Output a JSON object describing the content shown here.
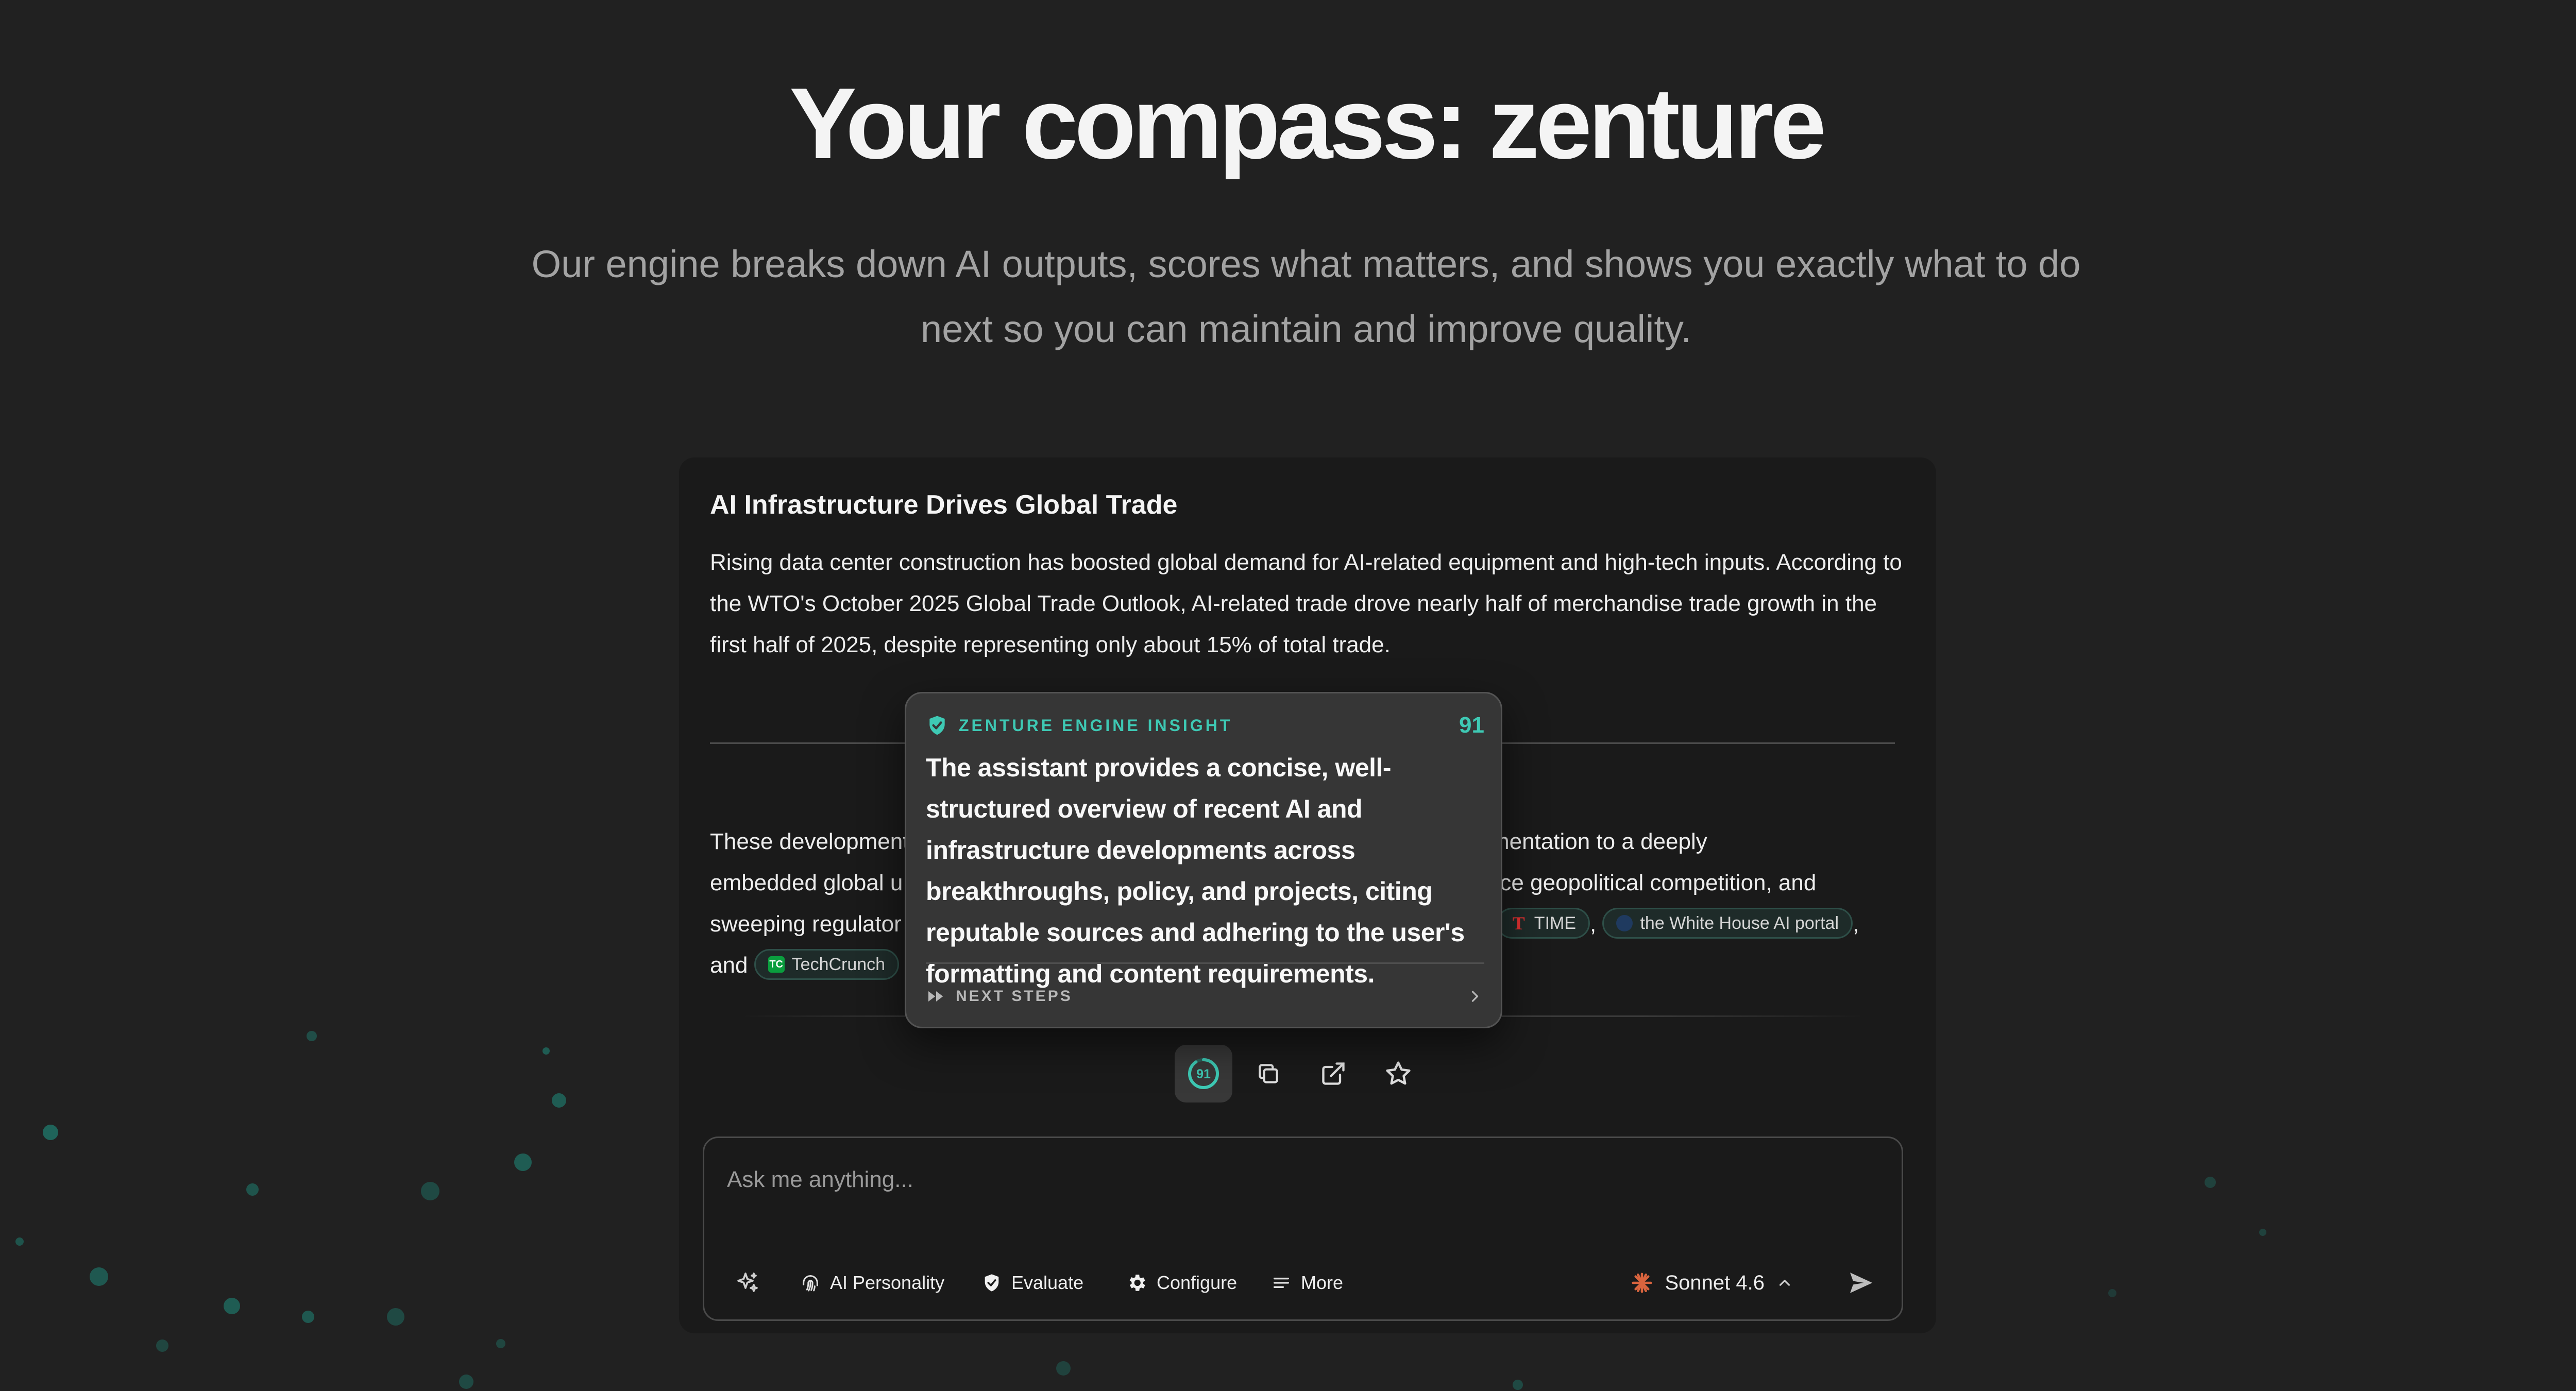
{
  "hero": {
    "title": "Your compass: zenture",
    "subtitle": "Our engine breaks down AI outputs, scores what matters, and shows you exactly what to do next so you can maintain and improve quality."
  },
  "article": {
    "title": "AI Infrastructure Drives Global Trade",
    "paragraph_1": "Rising data center construction has boosted global demand for AI-related equipment and high-tech inputs. According to the WTO's October 2025 Global Trade Outlook, AI-related trade drove nearly half of merchandise trade growth in the first half of 2025, despite representing only about 15% of total trade.",
    "paragraph_2": {
      "start": "These developments",
      "visible_mid_1": "n experimentation to a deeply",
      "line2_start": "embedded global u",
      "visible_mid_2": "erce geopolitical competition, and",
      "line3_start": "sweeping regulator",
      "comma": ",",
      "and": "and"
    },
    "sources": [
      {
        "name": "TIME",
        "icon": "time-logo",
        "color": "#e03131"
      },
      {
        "name": "the White House AI portal",
        "icon": "white-house-logo",
        "color": "#1f3a5f"
      },
      {
        "name": "TechCrunch",
        "icon": "techcrunch-logo",
        "color": "#0a9e3e",
        "abbr": "TC"
      }
    ]
  },
  "toolbar": {
    "score": "91",
    "items": [
      "score-ring-icon",
      "copy-icon",
      "share-icon",
      "star-icon"
    ]
  },
  "insight": {
    "label": "ZENTURE ENGINE INSIGHT",
    "score": "91",
    "text": "The assistant provides a concise, well-structured overview of recent AI and infrastructure developments across breakthroughs, policy, and projects, citing reputable sources and adhering to the user's formatting and content requirements.",
    "next_steps": "NEXT STEPS",
    "accent": "#3ec9b4"
  },
  "composer": {
    "placeholder": "Ask me anything...",
    "buttons": {
      "personality": "AI Personality",
      "evaluate": "Evaluate",
      "configure": "Configure",
      "more": "More"
    },
    "model": "Sonnet 4.6"
  }
}
